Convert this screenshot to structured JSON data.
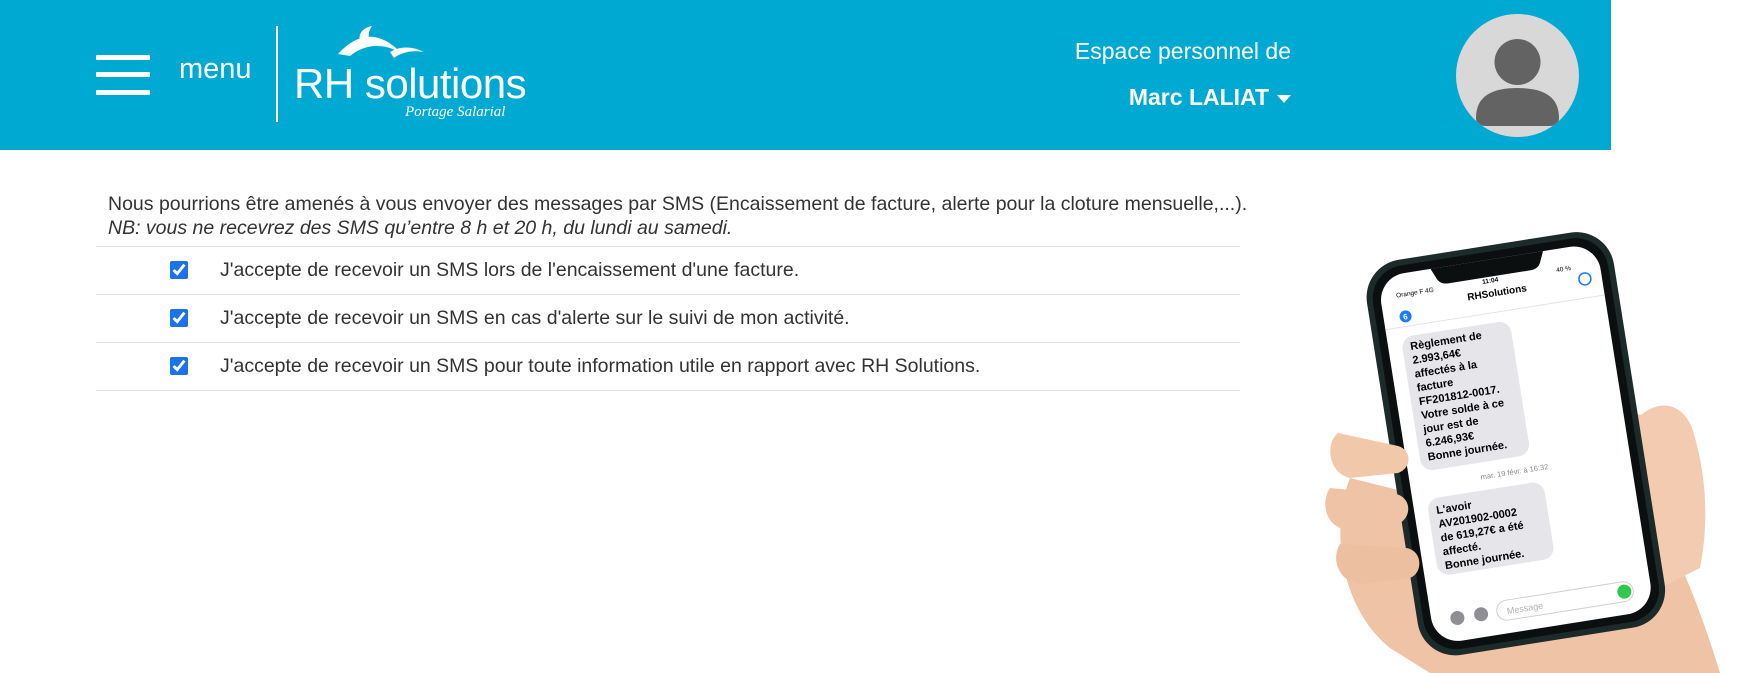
{
  "header": {
    "menu_label": "menu",
    "logo": {
      "brand": "RH solutions",
      "tagline": "Portage Salarial"
    },
    "welcome_text": "Espace personnel de",
    "user_name": "Marc LALIAT"
  },
  "main": {
    "intro_text": "Nous pourrions être amenés à vous envoyer des messages par SMS (Encaissement de facture, alerte pour la cloture mensuelle,...).",
    "nb_text": "NB: vous ne recevrez des SMS qu’entre 8 h et 20 h, du lundi au samedi.",
    "options": [
      {
        "label": "J'accepte de recevoir un SMS lors de l'encaissement d'une facture.",
        "checked": true
      },
      {
        "label": "J'accepte de recevoir un SMS en cas d'alerte sur le suivi de mon activité.",
        "checked": true
      },
      {
        "label": "J'accepte de recevoir un SMS pour toute information utile en rapport avec RH Solutions.",
        "checked": true
      }
    ]
  },
  "phone": {
    "carrier": "Orange F  4G",
    "time": "11:04",
    "battery": "40 %",
    "back_count": "6",
    "contact": "RHSolutions",
    "messages": [
      [
        "Règlement de",
        "2.993,64€",
        "affectés à la",
        "facture",
        "FF201812-0017.",
        "Votre solde à ce",
        "jour est de",
        "6.246,93€",
        "Bonne journée."
      ],
      [
        "L'avoir",
        "AV201902-0002",
        "de 619,27€ a été",
        "affecté.",
        "Bonne journée."
      ]
    ],
    "timestamp": "mar. 19 févr. à 16:32",
    "input_placeholder": "Message"
  },
  "colors": {
    "header_bg": "#00a9d2",
    "checkbox": "#1a73e8",
    "text": "#333333"
  }
}
